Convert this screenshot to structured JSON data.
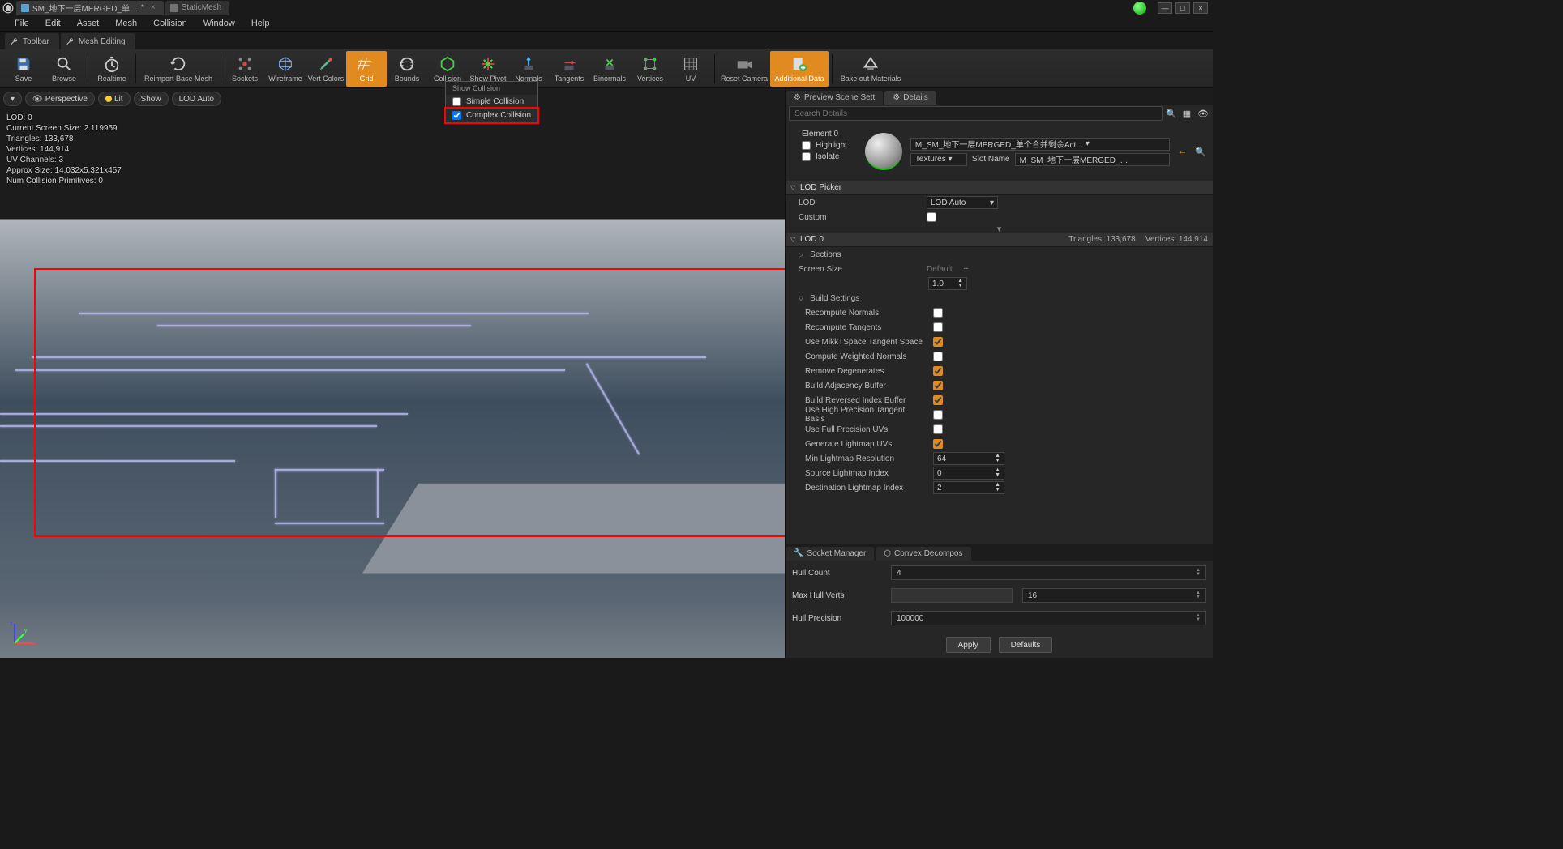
{
  "titlebar": {
    "tab1": "SM_地下一层MERGED_单…",
    "tab1_suffix": "*",
    "tab2": "StaticMesh"
  },
  "menu": [
    "File",
    "Edit",
    "Asset",
    "Mesh",
    "Collision",
    "Window",
    "Help"
  ],
  "subtabs": {
    "toolbar": "Toolbar",
    "mesh_editing": "Mesh Editing"
  },
  "toolbar": {
    "save": "Save",
    "browse": "Browse",
    "realtime": "Realtime",
    "reimport": "Reimport Base Mesh",
    "sockets": "Sockets",
    "wireframe": "Wireframe",
    "vertcolors": "Vert Colors",
    "grid": "Grid",
    "bounds": "Bounds",
    "collision": "Collision",
    "showpivot": "Show Pivot",
    "normals": "Normals",
    "tangents": "Tangents",
    "binormals": "Binormals",
    "vertices": "Vertices",
    "uv": "UV",
    "resetcamera": "Reset Camera",
    "additionaldata": "Additional Data",
    "bakeout": "Bake out Materials"
  },
  "vp_buttons": {
    "perspective": "Perspective",
    "lit": "Lit",
    "show": "Show",
    "lodauto": "LOD Auto"
  },
  "stats": {
    "l1": "LOD:  0",
    "l2": "Current Screen Size:  2.119959",
    "l3": "Triangles:  133,678",
    "l4": "Vertices:  144,914",
    "l5": "UV Channels:  3",
    "l6": "Approx Size: 14,032x5,321x457",
    "l7": "Num Collision Primitives:  0"
  },
  "dropdown": {
    "header": "Show Collision",
    "simple": "Simple Collision",
    "complex": "Complex Collision"
  },
  "right_tabs": {
    "scene": "Preview Scene Sett",
    "details": "Details"
  },
  "search_placeholder": "Search Details",
  "material": {
    "element": "Element 0",
    "highlight": "Highlight",
    "isolate": "Isolate",
    "name": "M_SM_地下一层MERGED_单个合并剩余Actor烘焙单材…",
    "textures_btn": "Textures ▾",
    "slot_label": "Slot Name",
    "slot_value": "M_SM_地下一层MERGED_单个合并剩"
  },
  "sections": {
    "lodpicker": {
      "title": "LOD Picker",
      "lod": "LOD",
      "lod_value": "LOD Auto",
      "custom": "Custom"
    },
    "lod0": {
      "title": "LOD 0",
      "triangles": "Triangles: 133,678",
      "vertices": "Vertices: 144,914",
      "sections": "Sections",
      "screensize": "Screen Size",
      "default": "Default",
      "ss_value": "1.0",
      "buildsettings": "Build Settings",
      "recompute_normals": "Recompute Normals",
      "recompute_tangents": "Recompute Tangents",
      "mikktspace": "Use MikkTSpace Tangent Space",
      "weighted_normals": "Compute Weighted Normals",
      "remove_degenerates": "Remove Degenerates",
      "adjacency": "Build Adjacency Buffer",
      "reversed_index": "Build Reversed Index Buffer",
      "high_precision_tangent": "Use High Precision Tangent Basis",
      "full_precision_uv": "Use Full Precision UVs",
      "generate_lightmap": "Generate Lightmap UVs",
      "min_lightmap_res": "Min Lightmap Resolution",
      "min_lightmap_val": "64",
      "src_lightmap_idx": "Source Lightmap Index",
      "src_lightmap_val": "0",
      "dst_lightmap_idx": "Destination Lightmap Index",
      "dst_lightmap_val": "2"
    }
  },
  "bottom_tabs": {
    "socket": "Socket Manager",
    "convex": "Convex Decompos"
  },
  "convex": {
    "hull_count": "Hull Count",
    "hull_count_val": "4",
    "max_hull_verts": "Max Hull Verts",
    "max_hull_verts_val": "16",
    "hull_precision": "Hull Precision",
    "hull_precision_val": "100000",
    "apply": "Apply",
    "defaults": "Defaults"
  }
}
